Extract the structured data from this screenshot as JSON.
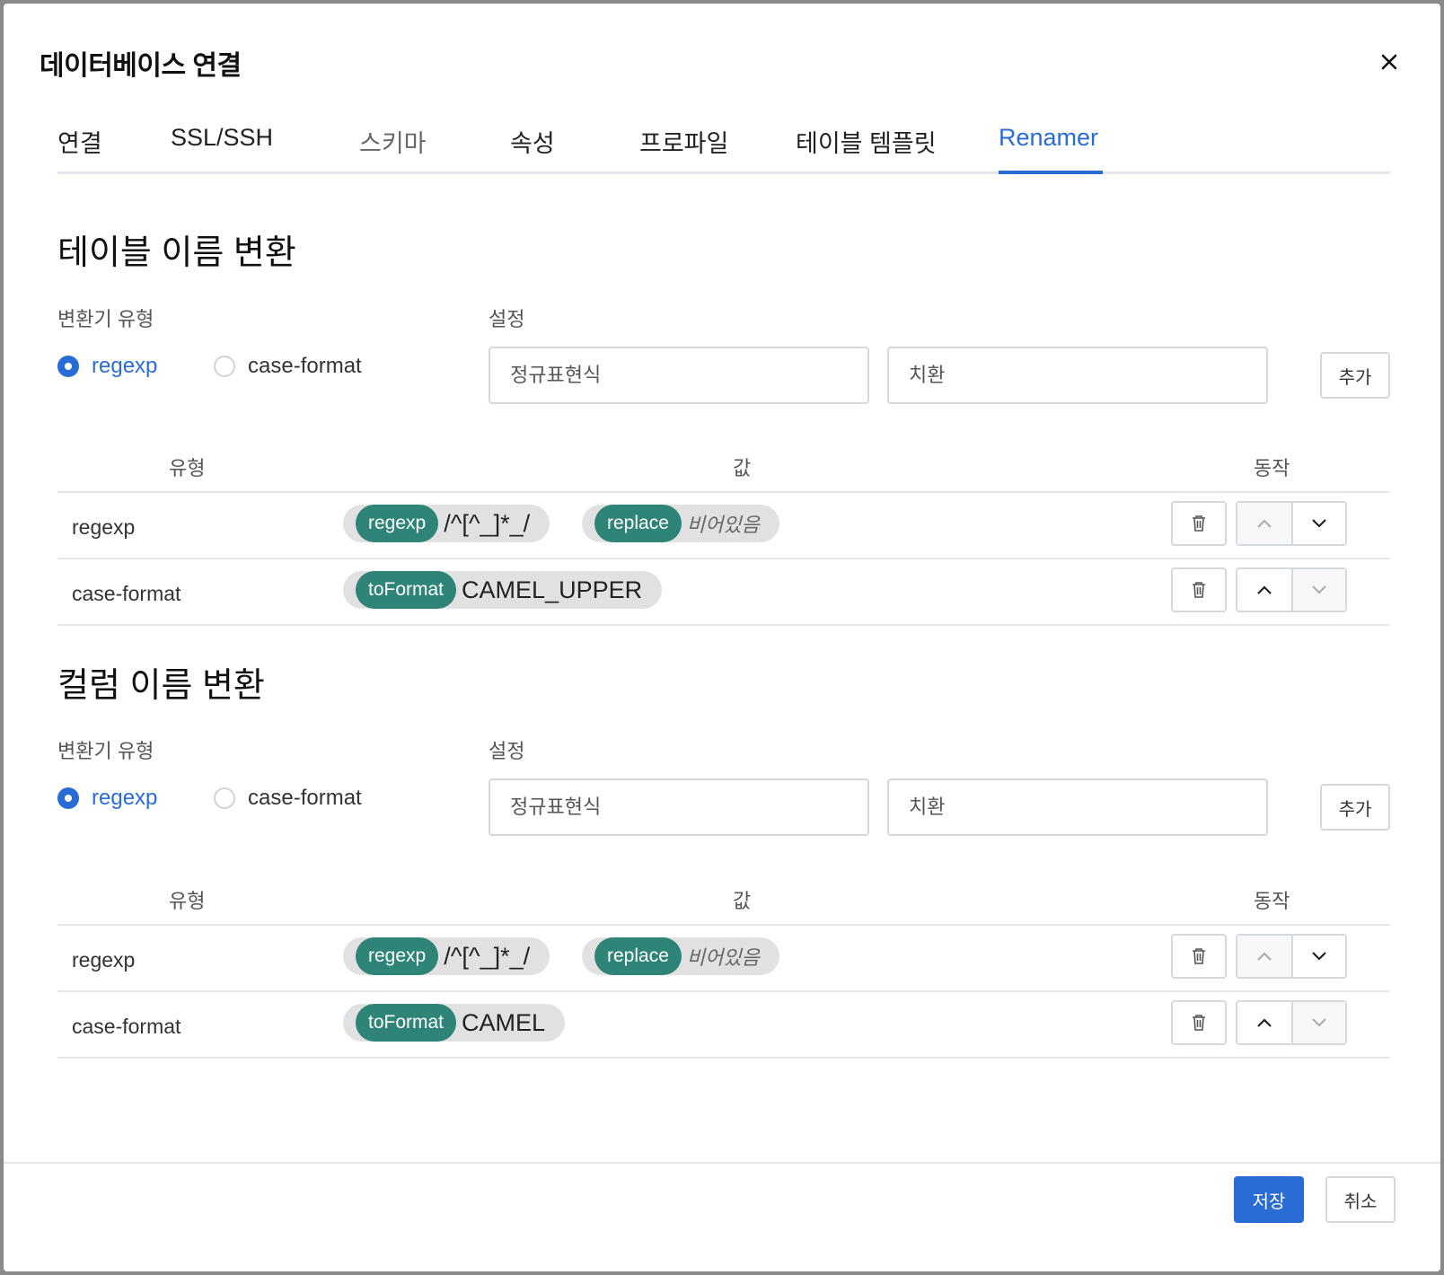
{
  "dialog": {
    "title": "데이터베이스 연결",
    "close_icon": "close-icon"
  },
  "tabs": [
    {
      "label": "연결",
      "state": "normal"
    },
    {
      "label": "SSL/SSH",
      "state": "normal"
    },
    {
      "label": "스키마",
      "state": "muted"
    },
    {
      "label": "속성",
      "state": "normal"
    },
    {
      "label": "프로파일",
      "state": "normal"
    },
    {
      "label": "테이블 템플릿",
      "state": "normal"
    },
    {
      "label": "Renamer",
      "state": "active"
    }
  ],
  "table_section": {
    "title": "테이블 이름 변환",
    "type_label": "변환기 유형",
    "settings_label": "설정",
    "radio_options": [
      "regexp",
      "case-format"
    ],
    "selected_option": "regexp",
    "regex_placeholder": "정규표현식",
    "replace_placeholder": "치환",
    "add_label": "추가",
    "headers": {
      "type": "유형",
      "value": "값",
      "action": "동작"
    },
    "rows": [
      {
        "type": "regexp",
        "pills": [
          {
            "key": "regexp",
            "value": "/^[^_]*_/"
          },
          {
            "key": "replace",
            "value": "비어있음",
            "empty": true
          }
        ]
      },
      {
        "type": "case-format",
        "pills": [
          {
            "key": "toFormat",
            "value": "CAMEL_UPPER"
          }
        ]
      }
    ]
  },
  "column_section": {
    "title": "컬럼 이름 변환",
    "type_label": "변환기 유형",
    "settings_label": "설정",
    "radio_options": [
      "regexp",
      "case-format"
    ],
    "selected_option": "regexp",
    "regex_placeholder": "정규표현식",
    "replace_placeholder": "치환",
    "add_label": "추가",
    "headers": {
      "type": "유형",
      "value": "값",
      "action": "동작"
    },
    "rows": [
      {
        "type": "regexp",
        "pills": [
          {
            "key": "regexp",
            "value": "/^[^_]*_/"
          },
          {
            "key": "replace",
            "value": "비어있음",
            "empty": true
          }
        ]
      },
      {
        "type": "case-format",
        "pills": [
          {
            "key": "toFormat",
            "value": "CAMEL"
          }
        ]
      }
    ]
  },
  "footer": {
    "save_label": "저장",
    "cancel_label": "취소"
  },
  "colors": {
    "accent": "#2a6cd6",
    "pill_key": "#2e8577",
    "pill_bg": "#e1e1e1"
  }
}
